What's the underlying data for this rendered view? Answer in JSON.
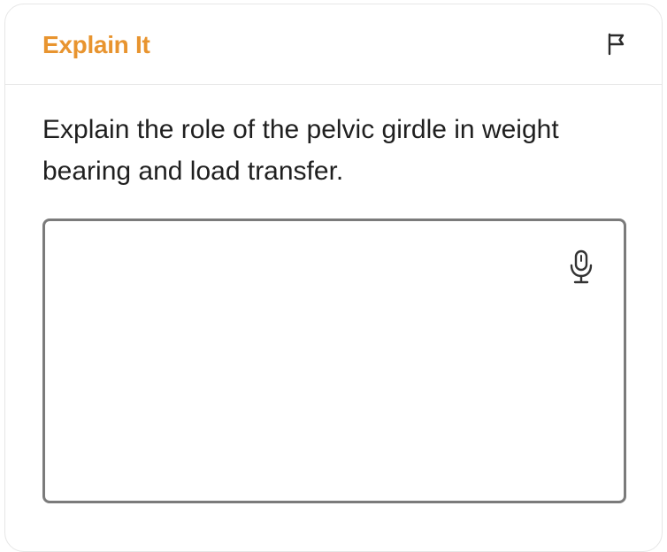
{
  "header": {
    "title": "Explain It",
    "flag_icon": "flag-icon"
  },
  "question": {
    "prompt": "Explain the role of the pelvic girdle in weight bearing and load transfer."
  },
  "answer": {
    "value": "",
    "placeholder": "",
    "mic_icon": "microphone-icon"
  },
  "colors": {
    "accent": "#e8942f",
    "text": "#1f1f1f",
    "border": "#7b7b7b",
    "icon": "#333333"
  }
}
